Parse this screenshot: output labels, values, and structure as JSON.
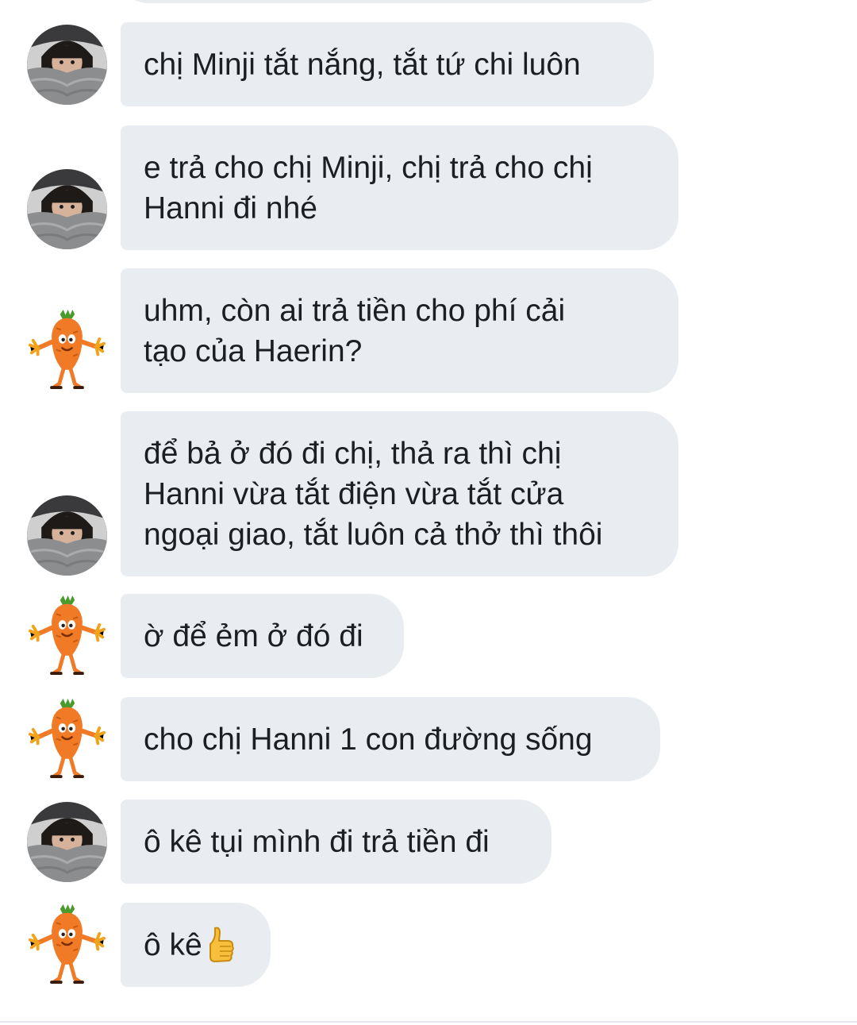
{
  "conversation": {
    "messages": [
      {
        "sender": "girl",
        "text": "chị Minji tắt nắng, tắt tứ chi luôn"
      },
      {
        "sender": "girl",
        "text": "e trả cho chị Minji, chị trả cho chị\nHanni đi nhé"
      },
      {
        "sender": "carrot",
        "text": "uhm, còn ai trả tiền cho phí cải\ntạo của Haerin?"
      },
      {
        "sender": "girl",
        "text": "để bả ở đó đi chị, thả ra thì chị\nHanni vừa tắt điện vừa tắt cửa\nngoại giao, tắt luôn cả thở thì thôi"
      },
      {
        "sender": "carrot",
        "text": "ờ để ẻm ở đó đi"
      },
      {
        "sender": "carrot",
        "text": "cho chị Hanni 1 con đường sống"
      },
      {
        "sender": "girl",
        "text": "ô kê tụi mình đi trả tiền đi"
      },
      {
        "sender": "carrot",
        "text": "ô kê",
        "emoji": "thumbs-up-icon"
      }
    ]
  },
  "colors": {
    "bubble": "#e9edf2",
    "text": "#1c1e21",
    "carrot": "#f07a26",
    "carrot_leaf": "#4a9a2e"
  }
}
